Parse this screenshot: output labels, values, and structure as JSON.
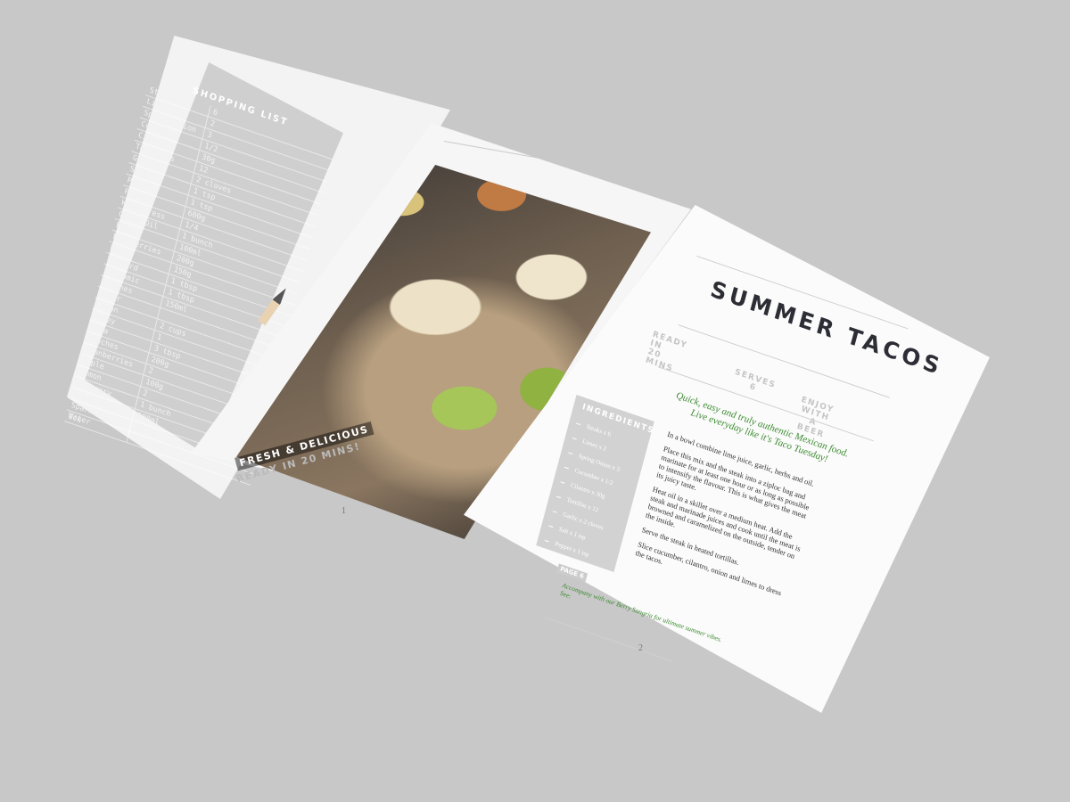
{
  "shopping_list": {
    "title": "SHOPPING LIST",
    "items": [
      {
        "item": "Steaks",
        "qty": "6"
      },
      {
        "item": "Limes",
        "qty": "2"
      },
      {
        "item": "Spring Onion",
        "qty": "3"
      },
      {
        "item": "Cucumber",
        "qty": "1/2"
      },
      {
        "item": "Cilantro",
        "qty": "30g"
      },
      {
        "item": "Tortillas",
        "qty": "12"
      },
      {
        "item": "Garlic",
        "qty": "2 cloves"
      },
      {
        "item": "Salt",
        "qty": "1 tsp"
      },
      {
        "item": "Pepper",
        "qty": "1 tsp"
      },
      {
        "item": "Prawns",
        "qty": "600g"
      },
      {
        "item": "Watercress",
        "qty": "1/4"
      },
      {
        "item": "Olive Oil",
        "qty": "1 bunch"
      },
      {
        "item": "Feta",
        "qty": "100ml"
      },
      {
        "item": "Blueberries",
        "qty": "200g"
      },
      {
        "item": "Honey",
        "qty": "150g"
      },
      {
        "item": "Mustard",
        "qty": "1 tbsp"
      },
      {
        "item": "Balsamic",
        "qty": "1 tbsp"
      },
      {
        "item": "Peaches",
        "qty": "150ml"
      },
      {
        "item": "Water",
        "qty": ""
      },
      {
        "item": "Lemon",
        "qty": "2 cups"
      },
      {
        "item": "Honey",
        "qty": "1"
      },
      {
        "item": "Feta",
        "qty": "3 tbsp"
      },
      {
        "item": "Peaches",
        "qty": "200g"
      },
      {
        "item": "Cranberries",
        "qty": "2"
      },
      {
        "item": "Apple",
        "qty": "100g"
      },
      {
        "item": "Lemon",
        "qty": "2"
      },
      {
        "item": "Rosemary",
        "qty": "1 bunch"
      },
      {
        "item": "White Wine",
        "qty": "180ml"
      },
      {
        "item": "Sparkling Water",
        "qty": "300ml"
      },
      {
        "item": "Ice",
        "qty": "1/2 bag"
      }
    ]
  },
  "photo": {
    "caption_1": "FRESH & DELICIOUS",
    "caption_2": "READY IN 20 MINS!",
    "page_number": "1"
  },
  "recipe": {
    "title": "SUMMER TACOS",
    "meta": {
      "ready": "READY IN\n20 MINS",
      "serves": "SERVES\n6",
      "enjoy": "ENJOY WITH\nA BEER"
    },
    "intro": "Quick, easy and truly authentic Mexican food. Live everyday like it's Taco Tuesday!",
    "ingredients_title": "INGREDIENTS",
    "ingredients": [
      "Steaks x 6",
      "Limes x 2",
      "Spring Onion x 3",
      "Cucumber x 1/2",
      "Cilantro x 30g",
      "Tortillas x 12",
      "Garlic x 2 cloves",
      "Salt x 1 tsp",
      "Pepper x 1 tsp"
    ],
    "method": [
      "In a bowl combine lime juice, garlic, herbs and oil.",
      "Place this mix and the steak into a ziploc bag and marinate for at least one hour or as long as possible to intensify the flavour. This is what gives the meat its juicy taste.",
      "Heat oil in a skillet over a medium heat. Add the steak and marinade juices and cook until the meat is browned and caramelized on the outside, tender on the inside.",
      "Serve the steak in heated tortillas.",
      "Slice cucumber, cilantro, onion and limes to dress the tacos."
    ],
    "page_tag": "PAGE 6",
    "accompany": "Accompany with our Berry Sangria for ultimate summer vibes. See:",
    "page_number": "2"
  }
}
